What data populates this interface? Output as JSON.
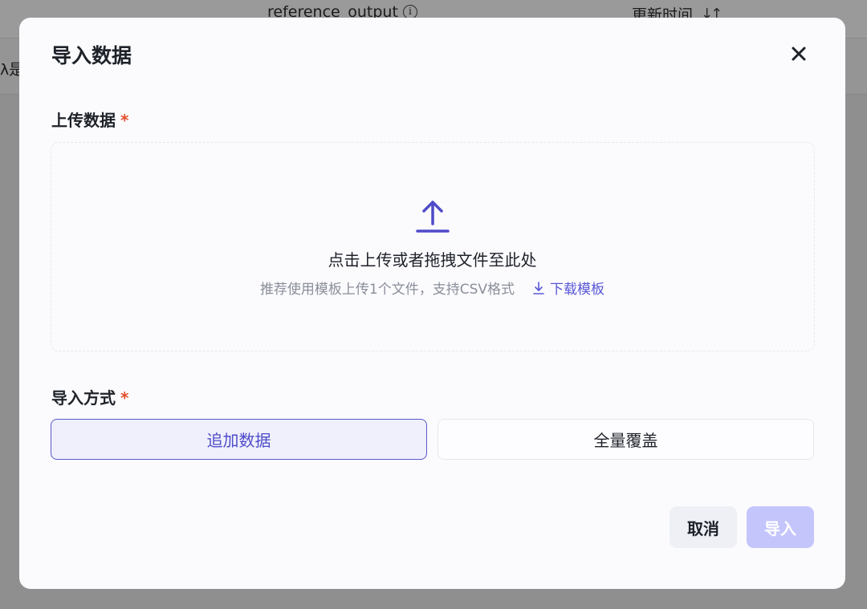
{
  "background": {
    "column_reference": "reference_output",
    "column_time": "更新时间",
    "row_cell_text": "λ是"
  },
  "modal": {
    "title": "导入数据",
    "upload": {
      "label": "上传数据",
      "required_mark": "*",
      "main_text": "点击上传或者拖拽文件至此处",
      "hint_text": "推荐使用模板上传1个文件，支持CSV格式",
      "download_template": "下载模板"
    },
    "import_mode": {
      "label": "导入方式",
      "required_mark": "*",
      "options": [
        {
          "label": "追加数据",
          "selected": true
        },
        {
          "label": "全量覆盖",
          "selected": false
        }
      ]
    },
    "footer": {
      "cancel_label": "取消",
      "import_label": "导入"
    }
  },
  "colors": {
    "accent": "#5a57c8",
    "required": "#e2512b",
    "import_disabled": "#c4c5fb"
  }
}
